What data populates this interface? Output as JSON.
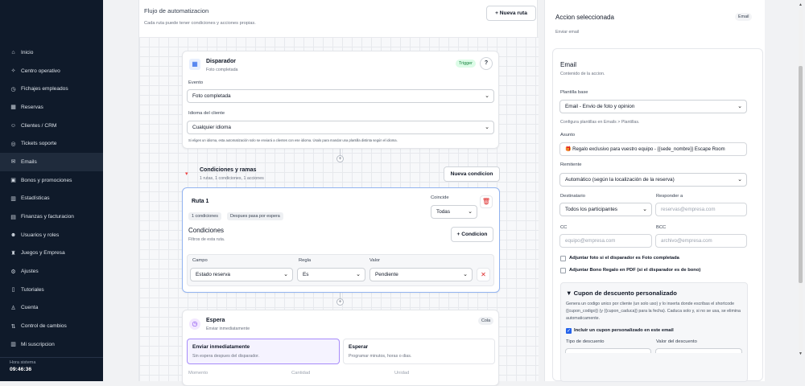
{
  "sidebar": {
    "items": [
      {
        "label": "Inicio",
        "icon": "home-icon",
        "glyph": "⌂"
      },
      {
        "label": "Centro operativo",
        "icon": "sparkle-icon",
        "glyph": "✧"
      },
      {
        "label": "Fichajes empleados",
        "icon": "clock-icon",
        "glyph": "◷"
      },
      {
        "label": "Reservas",
        "icon": "calendar-icon",
        "glyph": "▦"
      },
      {
        "label": "Clientes / CRM",
        "icon": "users-icon",
        "glyph": "☺"
      },
      {
        "label": "Tickets soporte",
        "icon": "support-icon",
        "glyph": "◎"
      },
      {
        "label": "Emails",
        "icon": "mail-icon",
        "glyph": "✉"
      },
      {
        "label": "Bonos y promociones",
        "icon": "gift-icon",
        "glyph": "▣"
      },
      {
        "label": "Estadísticas",
        "icon": "bar-chart-icon",
        "glyph": "▥"
      },
      {
        "label": "Finanzas y facturacion",
        "icon": "finance-icon",
        "glyph": "▤"
      },
      {
        "label": "Usuarios y roles",
        "icon": "user-group-icon",
        "glyph": "☻"
      },
      {
        "label": "Juegos y Empresa",
        "icon": "game-icon",
        "glyph": "♜"
      },
      {
        "label": "Ajustes",
        "icon": "gear-icon",
        "glyph": "⚙"
      },
      {
        "label": "Tutoriales",
        "icon": "book-icon",
        "glyph": "▯"
      },
      {
        "label": "Cuenta",
        "icon": "account-icon",
        "glyph": "♙"
      },
      {
        "label": "Control de cambios",
        "icon": "history-icon",
        "glyph": "⇅"
      },
      {
        "label": "Mi suscripcion",
        "icon": "subscription-icon",
        "glyph": "▥"
      }
    ],
    "active_index": 6,
    "system_label": "Hora sistema",
    "system_time": "09:46:36"
  },
  "flow": {
    "title": "Flujo de automatizacion",
    "subtitle": "Cada ruta puede tener condiciones y acciones propias.",
    "new_route_button": "+ Nueva ruta",
    "trigger": {
      "title": "Disparador",
      "subtitle": "Foto completada",
      "badge": "Trigger",
      "help": "?",
      "event_label": "Evento",
      "event_value": "Foto completada",
      "language_label": "Idioma del cliente",
      "language_value": "Cualquier idioma",
      "note": "Si eliges un idioma, esta automatización solo se enviará a clientes con ese idioma. Úsalo para mandar una plantilla distinta según el idioma."
    },
    "conditions": {
      "title": "Condiciones y ramas",
      "subtitle": "1 rutas, 1 condiciones, 1 acciones",
      "new_condition_button": "Nueva condicion"
    },
    "route": {
      "title": "Ruta 1",
      "chips": [
        "1 condiciones",
        "Despues pasa por espera"
      ],
      "match_label": "Coincide",
      "match_value": "Todas",
      "conditions_title": "Condiciones",
      "conditions_sub": "Filtros de esta ruta.",
      "add_condition_button": "+ Condicion",
      "field_label": "Campo",
      "rule_label": "Regla",
      "value_label": "Valor",
      "field_value": "Estado reserva",
      "rule_value": "Es",
      "value_value": "Pendiente"
    },
    "wait": {
      "title": "Espera",
      "subtitle": "Enviar inmediatamente",
      "badge": "Cola",
      "option1_title": "Enviar inmediatamente",
      "option1_sub": "Sin espera despues del disparador.",
      "option2_title": "Esperar",
      "option2_sub": "Programar minutos, horas o dias.",
      "col1": "Momento",
      "col2": "Cantidad",
      "col3": "Unidad"
    }
  },
  "panel": {
    "title": "Accion seleccionada",
    "badge": "Email",
    "subtitle": "Enviar email",
    "email": {
      "title": "Email",
      "subtitle": "Contenido de la accion.",
      "template_label": "Plantilla base",
      "template_value": "Email - Envio de foto y opinion",
      "template_hint": "Configura plantillas en Emails > Plantillas.",
      "subject_label": "Asunto",
      "subject_value": "🎁 Regalo exclusivo para vuestro equipo - {{sede_nombre}} Escape Room",
      "sender_label": "Remitente",
      "sender_value": "Automático (según la localización de la reserva)",
      "recipient_label": "Destinatario",
      "recipient_value": "Todos los participantes",
      "reply_label": "Responder a",
      "reply_placeholder": "reservas@empresa.com",
      "cc_label": "CC",
      "cc_placeholder": "equipo@empresa.com",
      "bcc_label": "BCC",
      "bcc_placeholder": "archivo@empresa.com",
      "attach_photo": "Adjuntar foto si el disparador es Foto completada",
      "attach_bono": "Adjuntar Bono Regalo en PDF (si el disparador es de bono)"
    },
    "coupon": {
      "title": "▼ Cupon de descuento personalizado",
      "desc": "Genera un codigo unico por cliente (un solo uso) y lo inserta donde escribas el shortcode {{cupon_codigo}} (y {{cupon_caduca}} para la fecha). Caduca solo y, si no se usa, se elimina automaticamente.",
      "include_label": "Incluir un cupon personalizado en este email",
      "type_label": "Tipo de descuento",
      "value_label": "Valor del descuento"
    }
  }
}
